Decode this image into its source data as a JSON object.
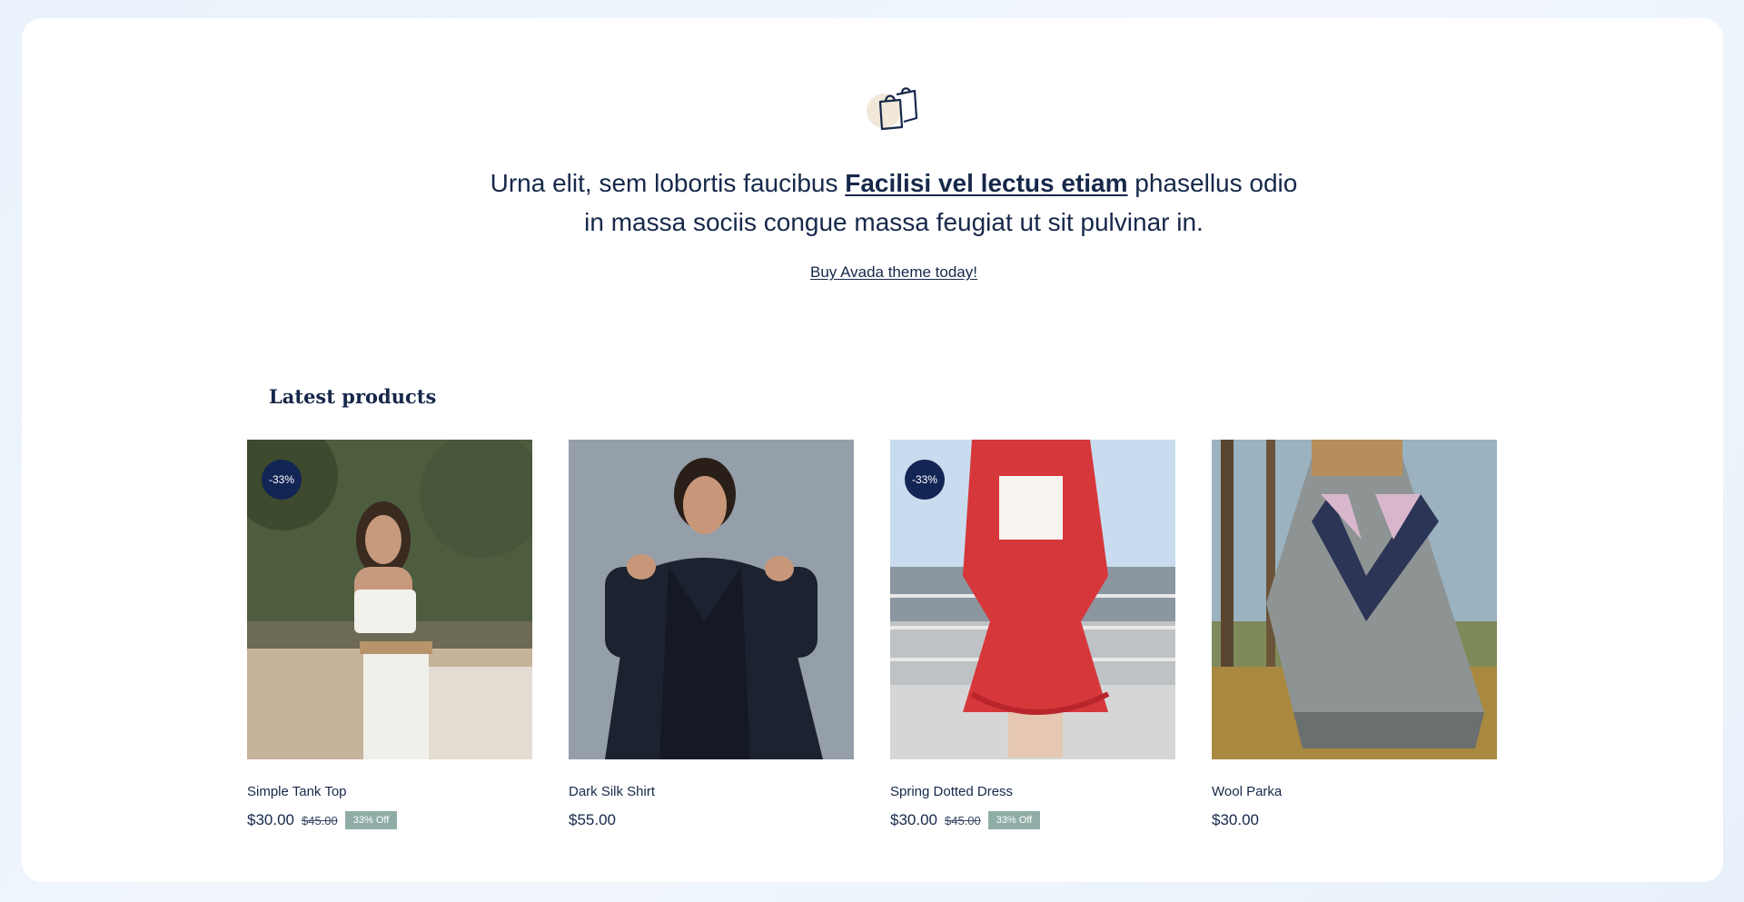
{
  "intro": {
    "before": "Urna elit, sem lobortis faucibus ",
    "link": "Facilisi vel lectus etiam",
    "after_line1": " phasellus odio",
    "line2": "in massa sociis congue massa feugiat ut sit pulvinar in."
  },
  "cta_label": "Buy Avada theme today!",
  "section_title": "Latest products",
  "icons": {
    "header": "shopping-bags-icon"
  },
  "colors": {
    "navy": "#122554",
    "off_badge": "#8fada6",
    "text": "#16284a"
  },
  "products": [
    {
      "name": "Simple Tank Top",
      "price": "$30.00",
      "old_price": "$45.00",
      "off_label": "33% Off",
      "badge": "-33%"
    },
    {
      "name": "Dark Silk Shirt",
      "price": "$55.00"
    },
    {
      "name": "Spring Dotted Dress",
      "price": "$30.00",
      "old_price": "$45.00",
      "off_label": "33% Off",
      "badge": "-33%"
    },
    {
      "name": "Wool Parka",
      "price": "$30.00"
    }
  ]
}
